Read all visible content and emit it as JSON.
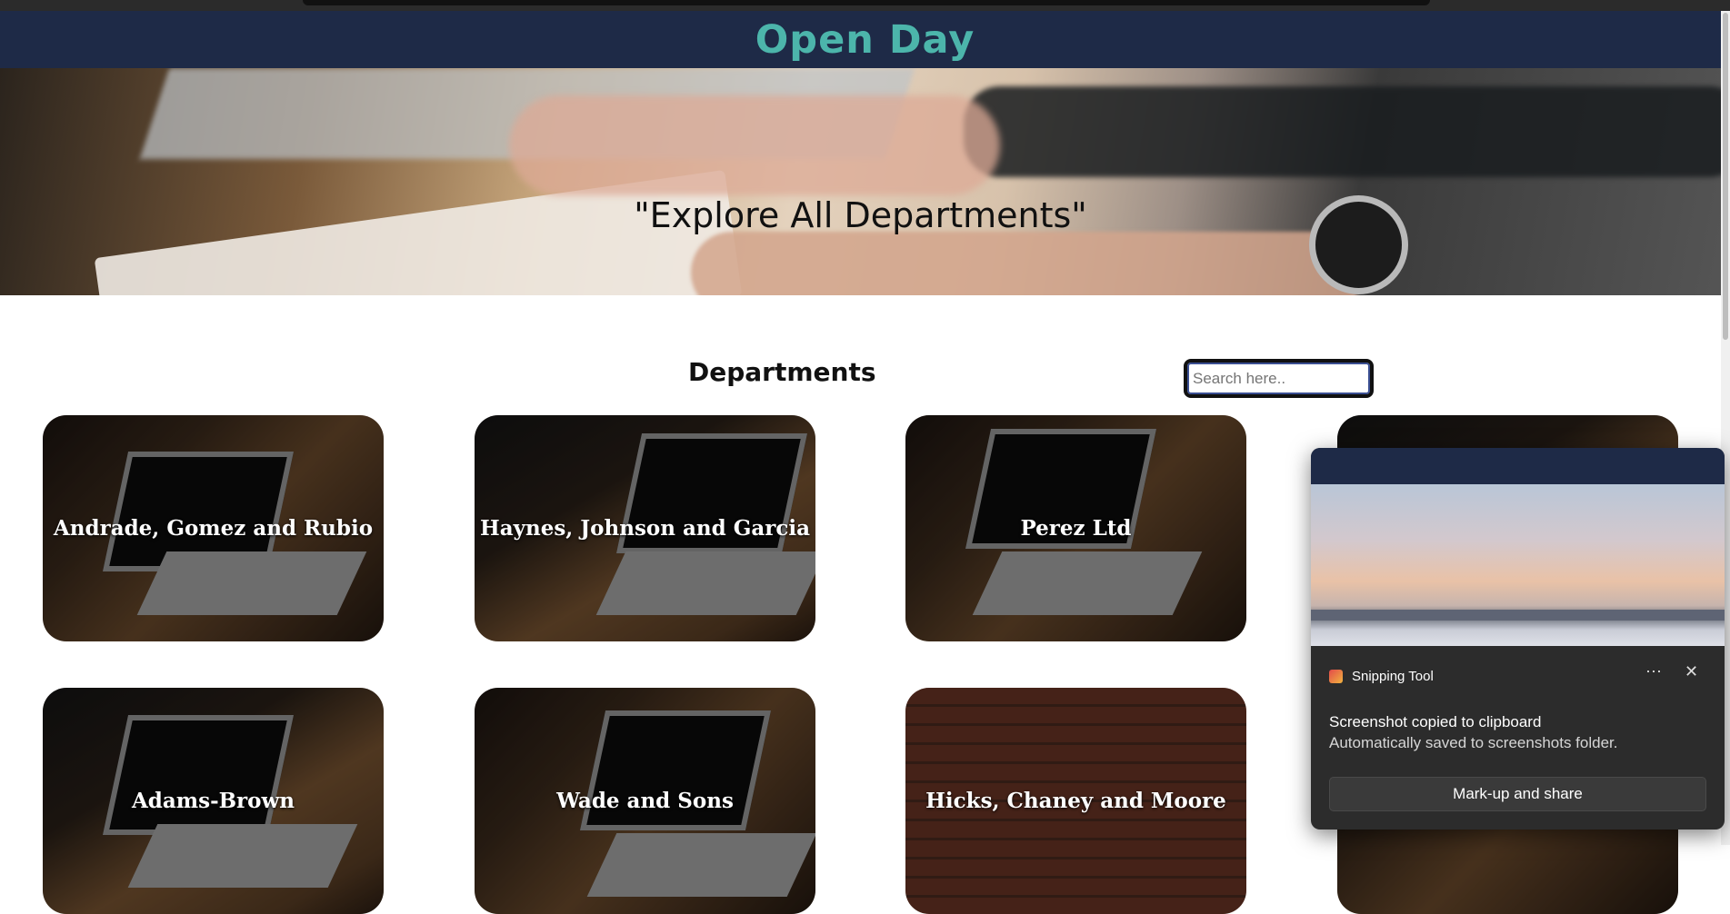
{
  "header": {
    "title": "Open Day"
  },
  "hero": {
    "quote": "\"Explore All Departments\""
  },
  "departments": {
    "title": "Departments",
    "search_placeholder": "Search here..",
    "cards": [
      {
        "name": "Andrade, Gomez and Rubio"
      },
      {
        "name": "Haynes, Johnson and Garcia"
      },
      {
        "name": "Perez Ltd"
      },
      {
        "name": ""
      },
      {
        "name": "Adams-Brown"
      },
      {
        "name": "Wade and Sons"
      },
      {
        "name": "Hicks, Chaney and Moore"
      },
      {
        "name": ""
      }
    ]
  },
  "notification": {
    "app_name": "Snipping Tool",
    "message": "Screenshot copied to clipboard",
    "detail": "Automatically saved to screenshots folder.",
    "action_label": "Mark-up and share",
    "more_icon": "more-icon",
    "close_icon": "close-icon"
  },
  "colors": {
    "header_bg": "#1e2a47",
    "title_accent": "#4cb5ab"
  }
}
